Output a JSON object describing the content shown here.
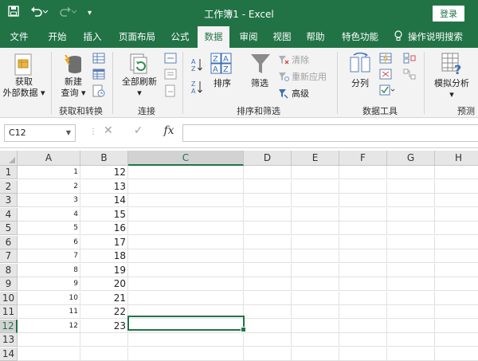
{
  "titlebar": {
    "title": "工作簿1 - Excel",
    "login_label": "登录",
    "save_icon": "save-icon",
    "undo_icon": "undo-icon",
    "redo_icon": "redo-icon"
  },
  "tabs": [
    "文件",
    "开始",
    "插入",
    "页面布局",
    "公式",
    "数据",
    "审阅",
    "视图",
    "帮助",
    "特色功能"
  ],
  "active_tab": "数据",
  "tell_me": "操作说明搜索",
  "ribbon": {
    "get_data_l1": "获取",
    "get_data_l2": "外部数据",
    "new_query_l1": "新建",
    "new_query_l2": "查询",
    "group_get_transform": "获取和转换",
    "refresh_all": "全部刷新",
    "group_connections": "连接",
    "sort": "排序",
    "filter": "筛选",
    "clear": "清除",
    "reapply": "重新应用",
    "advanced": "高级",
    "group_sort_filter": "排序和筛选",
    "text_to_columns": "分列",
    "group_data_tools": "数据工具",
    "what_if": "模拟分析",
    "group_forecast": "预测"
  },
  "formula_bar": {
    "name_box": "C12",
    "formula": ""
  },
  "columns": [
    "A",
    "B",
    "C",
    "D",
    "E",
    "F",
    "G",
    "H"
  ],
  "selected_column": "C",
  "selected_row": "12",
  "rows": [
    {
      "n": "1",
      "a": "1",
      "b": "12"
    },
    {
      "n": "2",
      "a": "2",
      "b": "13"
    },
    {
      "n": "3",
      "a": "3",
      "b": "14"
    },
    {
      "n": "4",
      "a": "4",
      "b": "15"
    },
    {
      "n": "5",
      "a": "5",
      "b": "16"
    },
    {
      "n": "6",
      "a": "6",
      "b": "17"
    },
    {
      "n": "7",
      "a": "7",
      "b": "18"
    },
    {
      "n": "8",
      "a": "8",
      "b": "19"
    },
    {
      "n": "9",
      "a": "9",
      "b": "20"
    },
    {
      "n": "10",
      "a": "10",
      "b": "21"
    },
    {
      "n": "11",
      "a": "11",
      "b": "22"
    },
    {
      "n": "12",
      "a": "12",
      "b": "23"
    },
    {
      "n": "13",
      "a": "",
      "b": ""
    },
    {
      "n": "14",
      "a": "",
      "b": ""
    }
  ],
  "colors": {
    "accent": "#217346"
  }
}
